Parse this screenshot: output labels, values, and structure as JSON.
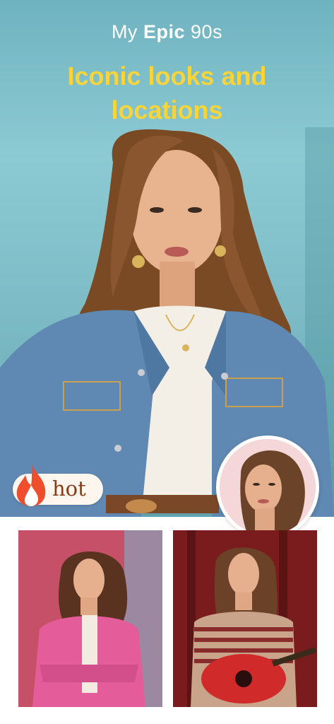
{
  "header": {
    "title_prefix": "My",
    "title_bold": "Epic",
    "title_suffix": "90s",
    "headline": "Iconic looks and locations"
  },
  "badge": {
    "label": "hot",
    "icon": "flame-icon"
  },
  "colors": {
    "headline": "#f7d53a",
    "hero_background": "#7dbcc6",
    "avatar_background": "#f6d7d9",
    "badge_text": "#8a3a12"
  },
  "gallery": {
    "items": [
      {
        "name": "pink-cardigan-look"
      },
      {
        "name": "guitar-look"
      }
    ]
  }
}
